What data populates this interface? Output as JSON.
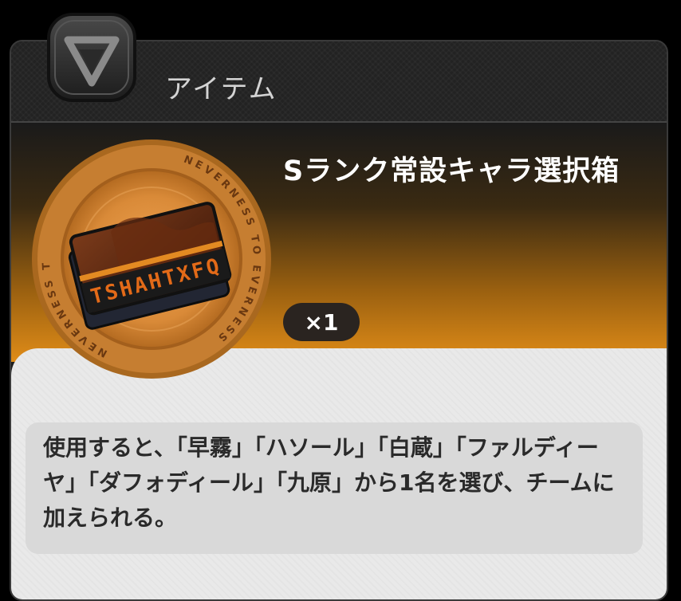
{
  "header": {
    "title": "アイテム",
    "logo_icon": "v-triangle-logo-icon"
  },
  "item": {
    "name": "Sランク常設キャラ選択箱",
    "count": "×1",
    "icon": "character-ticket-icon",
    "medallion_text": "NEVERNESS TO EVERNESS",
    "ticket_text": "TSHAHTXFQ"
  },
  "description": {
    "text": "使用すると、「早霧」「ハソール」「白蔵」「ファルディーヤ」「ダフォディール」「九原」から1名を選び、チームに加えられる。"
  },
  "colors": {
    "accent_orange": "#e08c18",
    "coin_gold": "#c98a3a",
    "panel_dark": "#222222",
    "desc_bg": "#e9e9e9"
  }
}
